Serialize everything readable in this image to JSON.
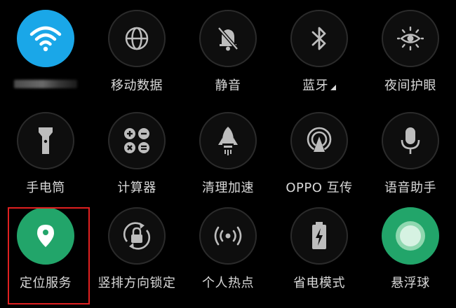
{
  "tiles": [
    {
      "name": "wifi-toggle",
      "label": "",
      "icon": "wifi-icon",
      "state": "on",
      "accent": "#1aa7e8"
    },
    {
      "name": "mobile-data-toggle",
      "label": "移动数据",
      "icon": "globe-icon",
      "state": "off"
    },
    {
      "name": "mute-toggle",
      "label": "静音",
      "icon": "bell-off-icon",
      "state": "off"
    },
    {
      "name": "bluetooth-toggle",
      "label": "蓝牙",
      "icon": "bluetooth-icon",
      "state": "off"
    },
    {
      "name": "eye-comfort-toggle",
      "label": "夜间护眼",
      "icon": "eye-sun-icon",
      "state": "off"
    },
    {
      "name": "flashlight-toggle",
      "label": "手电筒",
      "icon": "flashlight-icon",
      "state": "off"
    },
    {
      "name": "calculator-toggle",
      "label": "计算器",
      "icon": "calculator-icon",
      "state": "off"
    },
    {
      "name": "cleanup-toggle",
      "label": "清理加速",
      "icon": "rocket-icon",
      "state": "off"
    },
    {
      "name": "oppo-share-toggle",
      "label": "OPPO 互传",
      "icon": "share-signal-icon",
      "state": "off"
    },
    {
      "name": "voice-assistant-toggle",
      "label": "语音助手",
      "icon": "microphone-icon",
      "state": "off"
    },
    {
      "name": "location-toggle",
      "label": "定位服务",
      "icon": "location-pin-icon",
      "state": "on",
      "accent": "#22a56a"
    },
    {
      "name": "rotation-lock-toggle",
      "label": "竖排方向锁定",
      "icon": "rotation-lock-icon",
      "state": "off"
    },
    {
      "name": "hotspot-toggle",
      "label": "个人热点",
      "icon": "hotspot-icon",
      "state": "off"
    },
    {
      "name": "power-saving-toggle",
      "label": "省电模式",
      "icon": "battery-bolt-icon",
      "state": "off"
    },
    {
      "name": "floating-ball-toggle",
      "label": "悬浮球",
      "icon": "floating-ball-icon",
      "state": "on",
      "accent": "#22a56a"
    }
  ],
  "colors": {
    "background": "#000000",
    "tile_off": "#0e0e0e",
    "tile_border": "#2b2b2b",
    "icon_off": "#bdbdbd",
    "label": "#d9d9d9",
    "highlight": "#e02020"
  }
}
